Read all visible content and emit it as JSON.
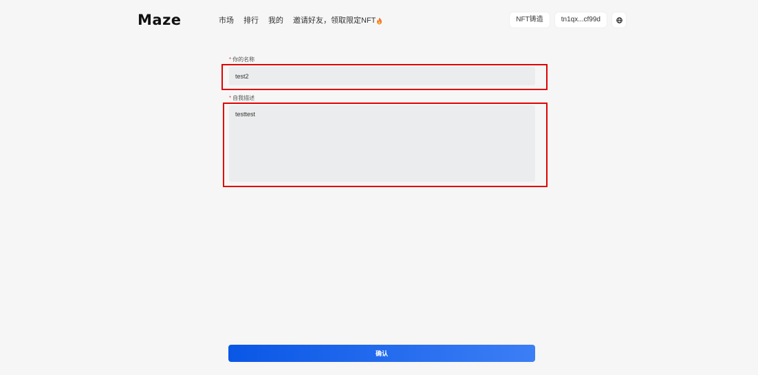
{
  "header": {
    "logo": "Maze",
    "nav": [
      {
        "label": "市场"
      },
      {
        "label": "排行"
      },
      {
        "label": "我的"
      },
      {
        "label": "邀请好友，领取限定NFT"
      }
    ],
    "mint_button": "NFT铸造",
    "wallet_address": "tn1qx...cf99d",
    "globe_icon": "globe-icon"
  },
  "form": {
    "name": {
      "required_mark": "*",
      "label": "你的名称",
      "value": "test2"
    },
    "bio": {
      "required_mark": "*",
      "label": "自我描述",
      "value": "testtest"
    },
    "confirm_label": "确认"
  },
  "colors": {
    "accent_start": "#0a57e6",
    "accent_end": "#3c7ef5",
    "highlight": "#e00000"
  }
}
